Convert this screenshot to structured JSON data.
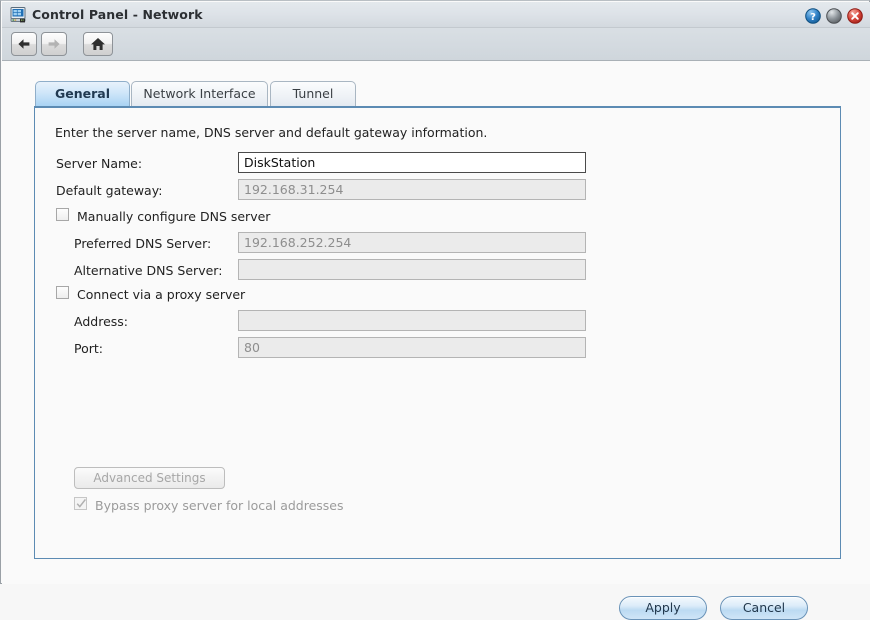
{
  "window": {
    "title": "Control Panel - Network",
    "icon": "network-monitor-icon",
    "controls": {
      "help_label": "?",
      "help_name": "help-icon",
      "minimize_name": "minimize-icon",
      "close_label": "✕",
      "close_name": "close-icon"
    }
  },
  "toolbar": {
    "back_name": "back-arrow-icon",
    "forward_name": "forward-arrow-icon",
    "home_name": "home-icon"
  },
  "tabs": [
    {
      "label": "General",
      "active": true
    },
    {
      "label": "Network Interface",
      "active": false
    },
    {
      "label": "Tunnel",
      "active": false
    }
  ],
  "form": {
    "intro": "Enter the server name, DNS server and default gateway information.",
    "server_name": {
      "label": "Server Name:",
      "value": "DiskStation",
      "placeholder": "",
      "enabled": true
    },
    "default_gateway": {
      "label": "Default gateway:",
      "value": "192.168.31.254",
      "enabled": false
    },
    "manual_dns": {
      "label": "Manually configure DNS server",
      "checked": false,
      "enabled": true
    },
    "preferred_dns": {
      "label": "Preferred DNS Server:",
      "value": "192.168.252.254",
      "enabled": false
    },
    "alternative_dns": {
      "label": "Alternative DNS Server:",
      "value": "",
      "enabled": false
    },
    "proxy": {
      "label": "Connect via a proxy server",
      "checked": false,
      "enabled": true
    },
    "proxy_address": {
      "label": "Address:",
      "value": "",
      "enabled": false
    },
    "proxy_port": {
      "label": "Port:",
      "value": "80",
      "enabled": false
    },
    "advanced_settings": {
      "label": "Advanced Settings",
      "enabled": false
    },
    "bypass_proxy": {
      "label": "Bypass proxy server for local addresses",
      "checked": true,
      "enabled": false
    }
  },
  "footer": {
    "apply_label": "Apply",
    "cancel_label": "Cancel"
  },
  "colors": {
    "titlebar_top": "#e4e9ed",
    "titlebar_bottom": "#d3d9df",
    "tab_active": "#a9d3f3",
    "panel_border": "#5c8bb3",
    "close_red": "#d94a3d",
    "help_blue": "#2b7cc4",
    "disabled_text": "#9b9b9b"
  }
}
